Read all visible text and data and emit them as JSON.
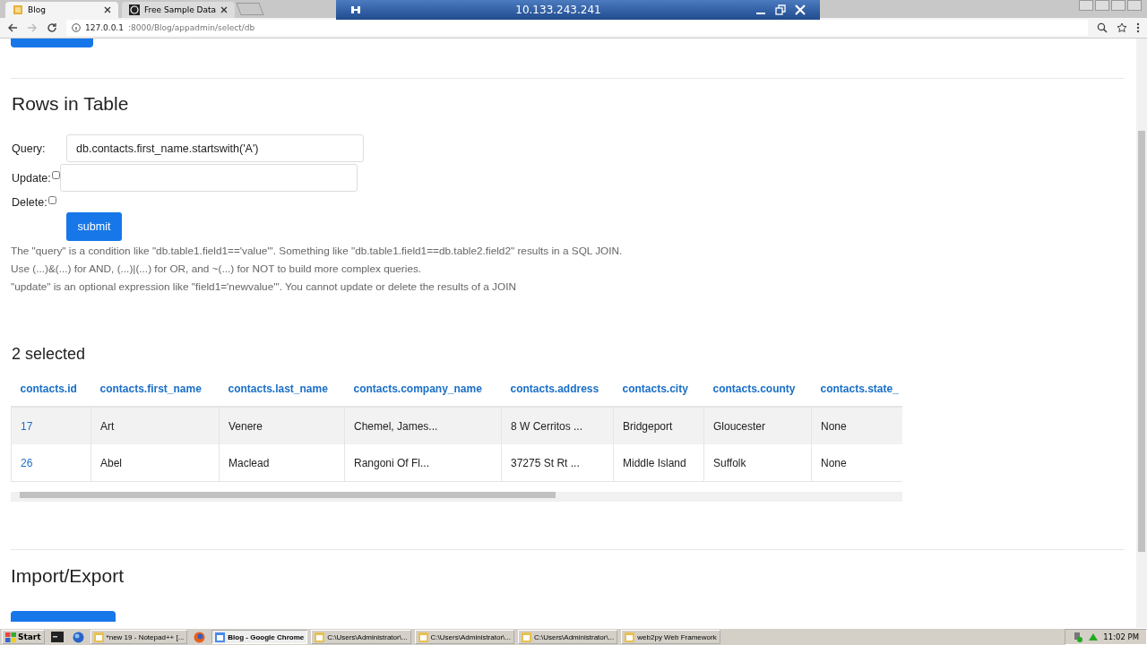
{
  "browser": {
    "tabs": [
      {
        "title": "Blog",
        "selected": true
      },
      {
        "title": "Free Sample Data",
        "selected": false
      }
    ],
    "remote_title": "10.133.243.241",
    "address_host": "127.0.0.1",
    "address_path": ":8000/Blog/appadmin/select/db"
  },
  "page": {
    "section_title": "Rows in Table",
    "form": {
      "query_label": "Query:",
      "query_value": "db.contacts.first_name.startswith('A')",
      "update_label": "Update:",
      "update_checked": false,
      "delete_label": "Delete:",
      "delete_checked": false,
      "submit": "submit"
    },
    "help": [
      "The \"query\" is a condition like \"db.table1.field1=='value'\". Something like \"db.table1.field1==db.table2.field2\" results in a SQL JOIN.",
      "Use (...)&(...) for AND, (...)|(...) for OR, and ~(...) for NOT to build more complex queries.",
      "\"update\" is an optional expression like \"field1='newvalue'\". You cannot update or delete the results of a JOIN"
    ],
    "selected_count": "2 selected",
    "table": {
      "columns": [
        "contacts.id",
        "contacts.first_name",
        "contacts.last_name",
        "contacts.company_name",
        "contacts.address",
        "contacts.city",
        "contacts.county",
        "contacts.state_"
      ],
      "rows": [
        [
          "17",
          "Art",
          "Venere",
          "Chemel, James...",
          "8 W Cerritos ...",
          "Bridgeport",
          "Gloucester",
          "None"
        ],
        [
          "26",
          "Abel",
          "Maclead",
          "Rangoni Of Fl...",
          "37275 St Rt ...",
          "Middle Island",
          "Suffolk",
          "None"
        ]
      ]
    },
    "next_section_title": "Import/Export"
  },
  "taskbar": {
    "start": "Start",
    "items": [
      {
        "label": "*new  19 - Notepad++ [...",
        "selected": false
      },
      {
        "label": "Blog - Google Chrome",
        "selected": true
      },
      {
        "label": "C:\\Users\\Administrator\\...",
        "selected": false
      },
      {
        "label": "C:\\Users\\Administrator\\...",
        "selected": false
      },
      {
        "label": "C:\\Users\\Administrator\\...",
        "selected": false
      },
      {
        "label": "web2py Web Framework",
        "selected": false
      }
    ],
    "clock": "11:02 PM"
  }
}
